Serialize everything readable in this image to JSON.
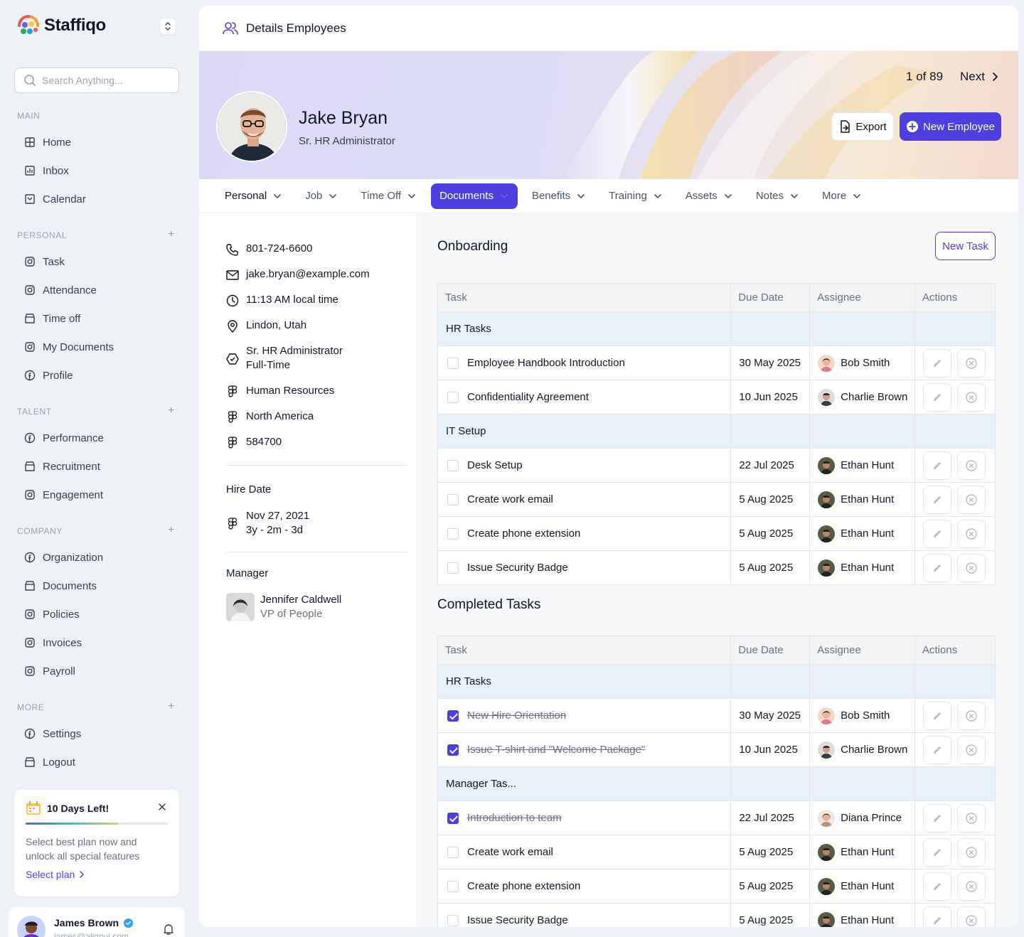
{
  "app": {
    "name": "Staffiqo"
  },
  "search": {
    "placeholder": "Search Anything..."
  },
  "sidebar": {
    "sections": [
      {
        "title": "MAIN",
        "items": [
          "Home",
          "Inbox",
          "Calendar"
        ]
      },
      {
        "title": "PERSONAL",
        "items": [
          "Task",
          "Attendance",
          "Time off",
          "My Documents",
          "Profile"
        ]
      },
      {
        "title": "TALENT",
        "items": [
          "Performance",
          "Recruitment",
          "Engagement"
        ]
      },
      {
        "title": "COMPANY",
        "items": [
          "Organization",
          "Documents",
          "Policies",
          "Invoices",
          "Payroll"
        ]
      },
      {
        "title": "MORE",
        "items": [
          "Settings",
          "Logout"
        ]
      }
    ]
  },
  "trial": {
    "title": "10 Days Left!",
    "progress_fraction": 0.65,
    "text": "Select best plan now and unlock all special features",
    "link": "Select plan"
  },
  "user": {
    "name": "James Brown",
    "email": "james@alignui.com"
  },
  "page": {
    "title": "Details Employees"
  },
  "employee": {
    "name": "Jake Bryan",
    "role": "Sr. HR Administrator"
  },
  "pager": {
    "position": "1 of 89",
    "next": "Next"
  },
  "actions": {
    "export": "Export",
    "new_employee": "New Employee"
  },
  "tabs": [
    "Personal",
    "Job",
    "Time Off",
    "Documents",
    "Benefits",
    "Training",
    "Assets",
    "Notes",
    "More"
  ],
  "active_tab": "Documents",
  "info": {
    "phone": "801-724-6600",
    "email": "jake.bryan@example.com",
    "local_time": "11:13 AM local time",
    "location": "Lindon, Utah",
    "title": "Sr. HR Administrator",
    "employment": "Full-Time",
    "department": "Human Resources",
    "region": "North America",
    "employee_id": "584700",
    "hire_date_label": "Hire Date",
    "hire_date": "Nov 27, 2021",
    "tenure": "3y - 2m - 3d",
    "manager_label": "Manager",
    "manager_name": "Jennifer Caldwell",
    "manager_title": "VP of People"
  },
  "onboarding": {
    "title": "Onboarding",
    "new_task": "New Task",
    "columns": [
      "Task",
      "Due Date",
      "Assignee",
      "Actions"
    ],
    "groups": [
      {
        "name": "HR Tasks",
        "rows": [
          {
            "task": "Employee Handbook Introduction",
            "due": "30 May 2025",
            "assignee": "Bob Smith",
            "done": false
          },
          {
            "task": "Confidentiality Agreement",
            "due": "10 Jun 2025",
            "assignee": "Charlie Brown",
            "done": false
          }
        ]
      },
      {
        "name": "IT Setup",
        "rows": [
          {
            "task": "Desk Setup",
            "due": "22 Jul 2025",
            "assignee": "Ethan Hunt",
            "done": false
          },
          {
            "task": "Create work email",
            "due": "5 Aug 2025",
            "assignee": "Ethan Hunt",
            "done": false
          },
          {
            "task": "Create phone extension",
            "due": "5 Aug 2025",
            "assignee": "Ethan Hunt",
            "done": false
          },
          {
            "task": "Issue Security Badge",
            "due": "5 Aug 2025",
            "assignee": "Ethan Hunt",
            "done": false
          }
        ]
      }
    ]
  },
  "completed": {
    "title": "Completed Tasks",
    "columns": [
      "Task",
      "Due Date",
      "Assignee",
      "Actions"
    ],
    "groups": [
      {
        "name": "HR Tasks",
        "rows": [
          {
            "task": "New Hire Orientation",
            "due": "30 May 2025",
            "assignee": "Bob Smith",
            "done": true
          },
          {
            "task": "Issue T-shirt and \"Welcome Package\"",
            "due": "10 Jun 2025",
            "assignee": "Charlie Brown",
            "done": true
          }
        ]
      },
      {
        "name": "Manager Tas...",
        "rows": [
          {
            "task": "Introduction to team",
            "due": "22 Jul 2025",
            "assignee": "Diana Prince",
            "done": true
          },
          {
            "task": "Create work email",
            "due": "5 Aug 2025",
            "assignee": "Ethan Hunt",
            "done": false
          },
          {
            "task": "Create phone extension",
            "due": "5 Aug 2025",
            "assignee": "Ethan Hunt",
            "done": false
          },
          {
            "task": "Issue Security Badge",
            "due": "5 Aug 2025",
            "assignee": "Ethan Hunt",
            "done": false
          }
        ]
      }
    ]
  },
  "colors": {
    "accent": "#4f3fe0",
    "group_row": "#e9f0f8",
    "sidebar_bg": "#eef2f7"
  }
}
